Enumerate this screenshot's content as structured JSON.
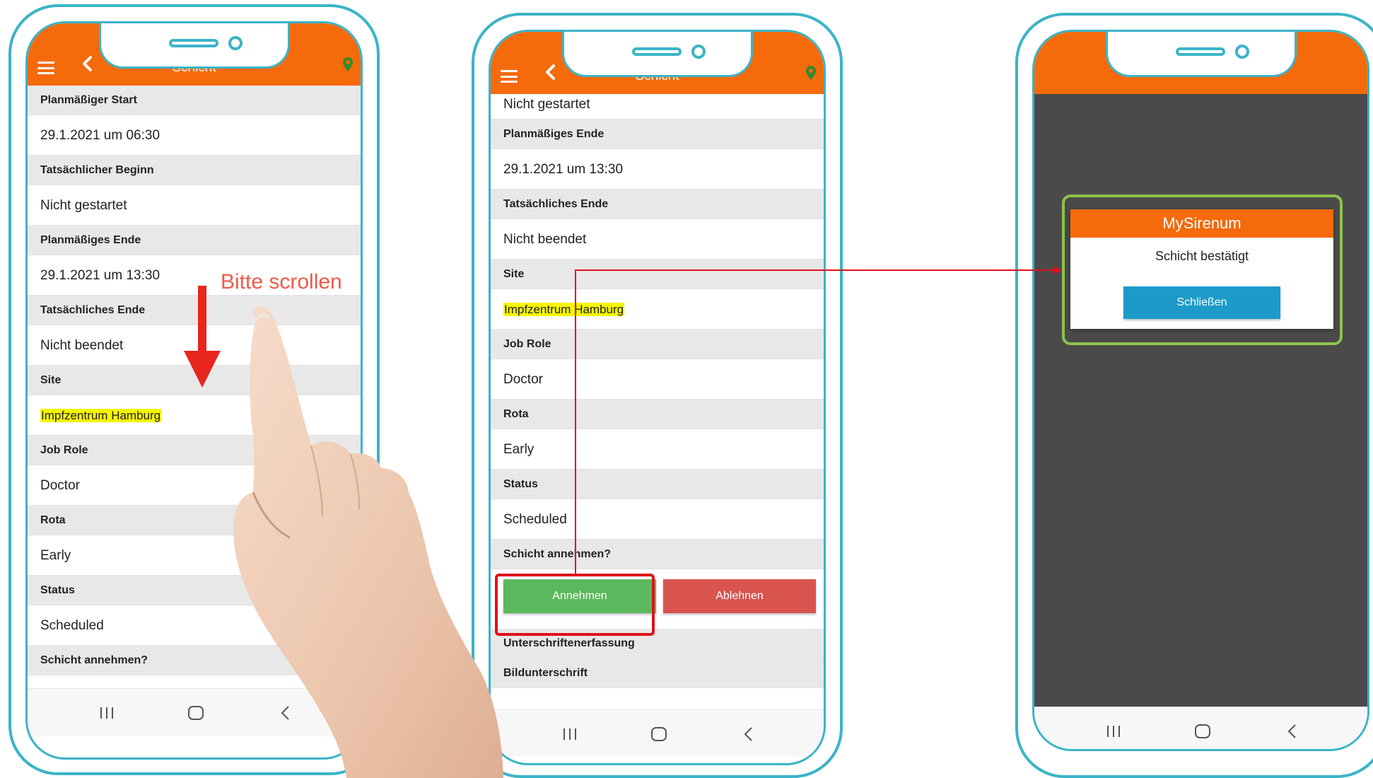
{
  "phone1": {
    "title": "Schicht",
    "rows": [
      {
        "type": "h",
        "text": "Planmäßiger Start"
      },
      {
        "type": "v",
        "text": "29.1.2021 um 06:30"
      },
      {
        "type": "h",
        "text": "Tatsächlicher Beginn"
      },
      {
        "type": "v",
        "text": "Nicht gestartet"
      },
      {
        "type": "h",
        "text": "Planmäßiges Ende"
      },
      {
        "type": "v",
        "text": "29.1.2021 um 13:30"
      },
      {
        "type": "h",
        "text": "Tatsächliches Ende"
      },
      {
        "type": "v",
        "text": "Nicht beendet"
      },
      {
        "type": "h",
        "text": "Site"
      },
      {
        "type": "v",
        "text": "Impfzentrum Hamburg",
        "highlight": true
      },
      {
        "type": "h",
        "text": "Job Role"
      },
      {
        "type": "v",
        "text": "Doctor"
      },
      {
        "type": "h",
        "text": "Rota"
      },
      {
        "type": "v",
        "text": "Early"
      },
      {
        "type": "h",
        "text": "Status"
      },
      {
        "type": "v",
        "text": "Scheduled"
      },
      {
        "type": "h",
        "text": "Schicht annehmen?"
      }
    ]
  },
  "annotation": {
    "scroll_hint": "Bitte scrollen",
    "arrow_color": "#e8261d"
  },
  "phone2": {
    "title": "Schicht",
    "rows": [
      {
        "type": "v",
        "text": "Nicht gestartet",
        "short": true
      },
      {
        "type": "h",
        "text": "Planmäßiges Ende"
      },
      {
        "type": "v",
        "text": "29.1.2021 um 13:30"
      },
      {
        "type": "h",
        "text": "Tatsächliches Ende"
      },
      {
        "type": "v",
        "text": "Nicht beendet"
      },
      {
        "type": "h",
        "text": "Site"
      },
      {
        "type": "v",
        "text": "Impfzentrum Hamburg",
        "highlight": true
      },
      {
        "type": "h",
        "text": "Job Role"
      },
      {
        "type": "v",
        "text": "Doctor"
      },
      {
        "type": "h",
        "text": "Rota"
      },
      {
        "type": "v",
        "text": "Early"
      },
      {
        "type": "h",
        "text": "Status"
      },
      {
        "type": "v",
        "text": "Scheduled"
      },
      {
        "type": "h",
        "text": "Schicht annehmen?"
      }
    ],
    "accept_label": "Annehmen",
    "decline_label": "Ablehnen",
    "after_rows": [
      "Unterschriftenerfassung",
      "Bildunterschrift"
    ]
  },
  "phone3": {
    "dialog": {
      "title": "MySirenum",
      "message": "Schicht bestätigt",
      "close_label": "Schließen"
    }
  },
  "colors": {
    "brand_orange": "#f56a0b",
    "accept_green": "#5cb85c",
    "decline_red": "#d9534f",
    "close_blue": "#1e9ac9",
    "frame_teal": "#3ab4c8",
    "highlight_yellow": "#f5f500",
    "location_pin_green": "#2e8b2e",
    "dialog_frame_green": "#8bc34a"
  },
  "icons": [
    "menu-icon",
    "back-arrow-icon",
    "location-pin-icon",
    "recent-apps-icon",
    "home-icon",
    "nav-back-icon"
  ]
}
